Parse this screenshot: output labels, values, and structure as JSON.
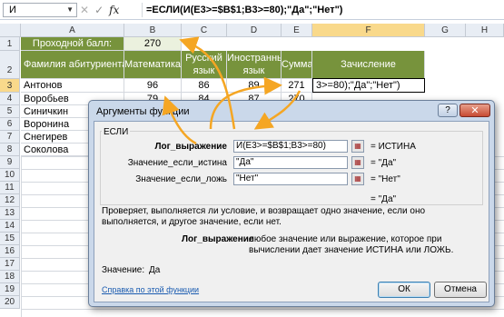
{
  "formula_bar": {
    "name_box": "И",
    "cancel_glyph": "✕",
    "enter_glyph": "✓",
    "fx_label": "fx",
    "formula": "=ЕСЛИ(И(E3>=$B$1;B3>=80);\"Да\";\"Нет\")"
  },
  "columns": [
    "A",
    "B",
    "C",
    "D",
    "E",
    "F",
    "G",
    "H"
  ],
  "rows": [
    "1",
    "2",
    "3",
    "4",
    "5",
    "6",
    "7",
    "8",
    "9",
    "10",
    "11",
    "12",
    "13",
    "14",
    "15",
    "16",
    "17",
    "18",
    "19",
    "20"
  ],
  "sheet": {
    "pass_label": "Проходной балл:",
    "pass_value": "270",
    "headers": {
      "surname": "Фамилия абитуриента",
      "math": "Математика",
      "russian": "Русский язык",
      "foreign": "Иностранный язык",
      "sum": "Сумма",
      "enroll": "Зачисление"
    },
    "students": [
      {
        "name": "Антонов",
        "math": "96",
        "russian": "86",
        "foreign": "89",
        "sum": "271",
        "enroll": "3>=80);\"Да\";\"Нет\")"
      },
      {
        "name": "Воробьев",
        "math": "79",
        "russian": "84",
        "foreign": "87",
        "sum": "270",
        "enroll": ""
      },
      {
        "name": "Синичкин",
        "math": "",
        "russian": "",
        "foreign": "",
        "sum": "",
        "enroll": ""
      },
      {
        "name": "Воронина",
        "math": "",
        "russian": "",
        "foreign": "",
        "sum": "",
        "enroll": ""
      },
      {
        "name": "Снегирев",
        "math": "",
        "russian": "",
        "foreign": "",
        "sum": "",
        "enroll": ""
      },
      {
        "name": "Соколова",
        "math": "",
        "russian": "",
        "foreign": "",
        "sum": "",
        "enroll": ""
      }
    ]
  },
  "dialog": {
    "title": "Аргументы функции",
    "help_glyph": "?",
    "close_glyph": "✕",
    "function_name": "ЕСЛИ",
    "args": [
      {
        "label": "Лог_выражение",
        "value": "И(E3>=$B$1;B3>=80)",
        "result": "=  ИСТИНА"
      },
      {
        "label": "Значение_если_истина",
        "value": "\"Да\"",
        "result": "=  \"Да\""
      },
      {
        "label": "Значение_если_ложь",
        "value": "\"Нет\"",
        "result": "=  \"Нет\""
      }
    ],
    "overall_result": "=  \"Да\"",
    "description": "Проверяет, выполняется ли условие, и возвращает одно значение, если оно выполняется, и другое значение, если нет.",
    "arg_help_name": "Лог_выражение",
    "arg_help_text": "любое значение или выражение, которое при вычислении дает значение ИСТИНА или ЛОЖЬ.",
    "value_label": "Значение:",
    "value_result": "Да",
    "help_link": "Справка по этой функции",
    "ok_label": "ОК",
    "cancel_label": "Отмена"
  },
  "colors": {
    "header_green": "#77933c",
    "annotation_arrow": "#f5a623",
    "row_col_highlight": "#f9d98b"
  }
}
